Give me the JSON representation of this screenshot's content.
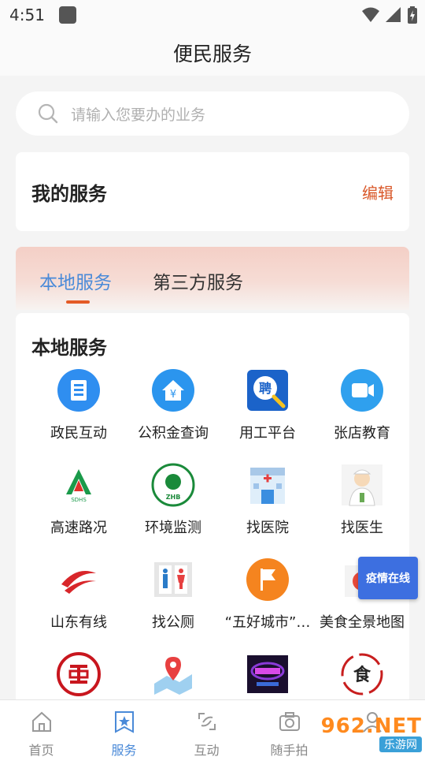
{
  "status_bar": {
    "time": "4:51"
  },
  "header": {
    "title": "便民服务"
  },
  "search": {
    "placeholder": "请输入您要办的业务"
  },
  "my_services": {
    "title": "我的服务",
    "edit_label": "编辑"
  },
  "tabs": [
    {
      "label": "本地服务",
      "active": true
    },
    {
      "label": "第三方服务",
      "active": false
    }
  ],
  "local_section": {
    "title": "本地服务",
    "items": [
      {
        "label": "政民互动",
        "icon": "document-icon",
        "color": "#2f8ef0"
      },
      {
        "label": "公积金查询",
        "icon": "house-yuan-icon",
        "color": "#2b95ee"
      },
      {
        "label": "用工平台",
        "icon": "hire-search-icon",
        "color": "#1b63c9"
      },
      {
        "label": "张店教育",
        "icon": "video-icon",
        "color": "#2fa0ee"
      },
      {
        "label": "高速路况",
        "icon": "sdhs-logo-icon",
        "color": "#1a9a4a"
      },
      {
        "label": "环境监测",
        "icon": "zhb-emblem-icon",
        "color": "#1a8a3a"
      },
      {
        "label": "找医院",
        "icon": "hospital-icon",
        "color": "#3a8ee0"
      },
      {
        "label": "找医生",
        "icon": "doctor-icon",
        "color": "#6aaa55"
      },
      {
        "label": "山东有线",
        "icon": "cable-logo-icon",
        "color": "#d8262a"
      },
      {
        "label": "找公厕",
        "icon": "toilet-icon",
        "color": "#2a7bc8"
      },
      {
        "label": "“五好城市”…",
        "icon": "flag-icon",
        "color": "#f5841f"
      },
      {
        "label": "美食全景地图",
        "icon": "food-map-icon",
        "color": "#e84a3a"
      },
      {
        "label": "",
        "icon": "bank-logo-icon",
        "color": "#c8161e"
      },
      {
        "label": "",
        "icon": "map-pin-icon",
        "color": "#e84040"
      },
      {
        "label": "",
        "icon": "neon-sign-icon",
        "color": "#8a3ad8"
      },
      {
        "label": "",
        "icon": "food-brand-icon",
        "color": "#c81e1e"
      }
    ]
  },
  "float_badge": {
    "label": "疫情在线"
  },
  "bottom_nav": [
    {
      "label": "首页",
      "icon": "home-icon",
      "active": false
    },
    {
      "label": "服务",
      "icon": "service-star-icon",
      "active": true
    },
    {
      "label": "互动",
      "icon": "interact-icon",
      "active": false
    },
    {
      "label": "随手拍",
      "icon": "camera-icon",
      "active": false
    },
    {
      "label": "",
      "icon": "user-icon",
      "active": false
    }
  ],
  "watermark": {
    "main": "962.NET",
    "sub": "乐游网"
  },
  "colors": {
    "accent": "#4a8ad8",
    "edit": "#d9582a",
    "tab_indicator": "#e45a24"
  }
}
